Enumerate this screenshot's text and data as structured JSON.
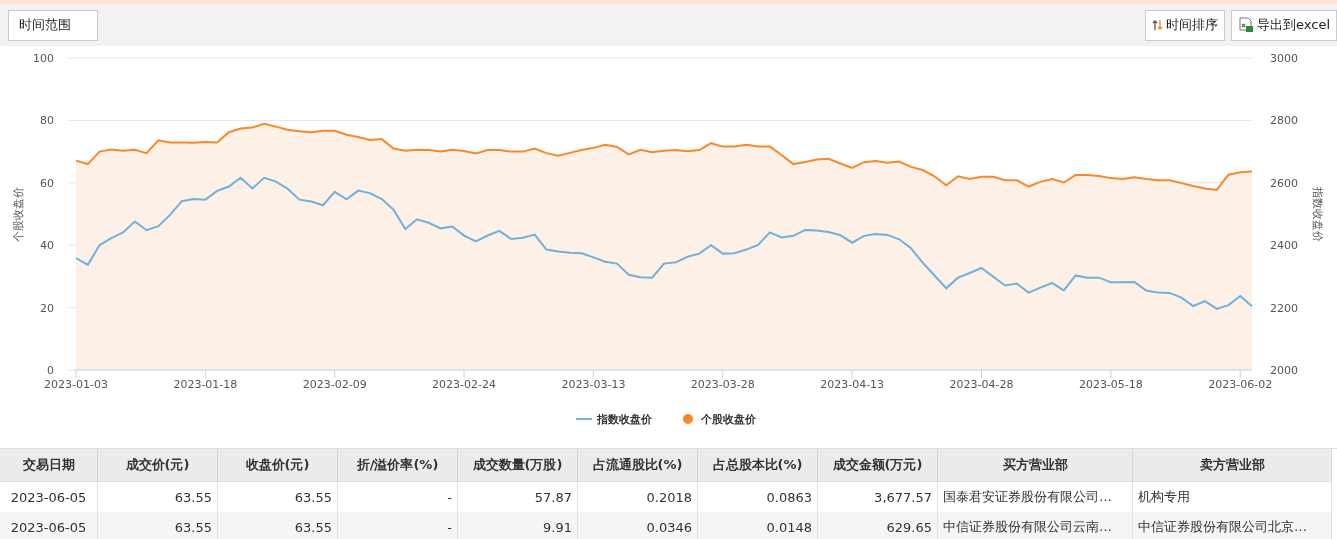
{
  "toolbar": {
    "range_button": "时间范围",
    "sort_button": "时间排序",
    "export_button": "导出到excel"
  },
  "chart": {
    "chart_data": {
      "type": "line",
      "categories": [
        "2023-01-03",
        null,
        null,
        null,
        null,
        null,
        null,
        null,
        null,
        null,
        null,
        "2023-01-18",
        null,
        null,
        null,
        null,
        null,
        null,
        null,
        null,
        null,
        null,
        "2023-02-09",
        null,
        null,
        null,
        null,
        null,
        null,
        null,
        null,
        null,
        null,
        "2023-02-24",
        null,
        null,
        null,
        null,
        null,
        null,
        null,
        null,
        null,
        null,
        "2023-03-13",
        null,
        null,
        null,
        null,
        null,
        null,
        null,
        null,
        null,
        null,
        "2023-03-28",
        null,
        null,
        null,
        null,
        null,
        null,
        null,
        null,
        null,
        null,
        "2023-04-13",
        null,
        null,
        null,
        null,
        null,
        null,
        null,
        null,
        null,
        null,
        "2023-04-28",
        null,
        null,
        null,
        null,
        null,
        null,
        null,
        null,
        null,
        null,
        "2023-05-18",
        null,
        null,
        null,
        null,
        null,
        null,
        null,
        null,
        null,
        null,
        "2023-06-02",
        null
      ],
      "grid": true,
      "legend": "bottom",
      "ylabel": "个股收盘价",
      "ylim": [
        0,
        100
      ],
      "yticks": [
        0,
        20,
        40,
        60,
        80,
        100
      ],
      "y2label": "指数收盘价",
      "y2lim": [
        2000,
        3000
      ],
      "y2ticks": [
        2000,
        2200,
        2400,
        2600,
        2800,
        3000
      ],
      "series": [
        {
          "name": "指数收盘价",
          "color": "#6fb0dd",
          "axis": "y2",
          "values": [
            2359,
            2337,
            2400,
            2423,
            2441,
            2476,
            2448,
            2461,
            2497,
            2541,
            2548,
            2546,
            2574,
            2588,
            2616,
            2582,
            2616,
            2604,
            2581,
            2546,
            2540,
            2528,
            2571,
            2547,
            2575,
            2567,
            2548,
            2514,
            2452,
            2483,
            2472,
            2454,
            2460,
            2431,
            2412,
            2431,
            2446,
            2420,
            2424,
            2434,
            2386,
            2380,
            2376,
            2374,
            2361,
            2347,
            2341,
            2305,
            2297,
            2296,
            2341,
            2345,
            2363,
            2373,
            2400,
            2373,
            2374,
            2386,
            2401,
            2441,
            2425,
            2430,
            2449,
            2447,
            2442,
            2432,
            2408,
            2430,
            2436,
            2433,
            2419,
            2390,
            2344,
            2303,
            2262,
            2296,
            2311,
            2327,
            2299,
            2271,
            2277,
            2248,
            2264,
            2279,
            2255,
            2303,
            2296,
            2296,
            2281,
            2281,
            2282,
            2255,
            2248,
            2247,
            2232,
            2205,
            2221,
            2196,
            2208,
            2237,
            2204
          ]
        },
        {
          "name": "个股收盘价",
          "color": "#f7892b",
          "type": "area",
          "values": [
            67.1,
            66,
            70,
            70.7,
            70.3,
            70.6,
            69.5,
            73.6,
            72.9,
            72.9,
            72.8,
            73.1,
            72.9,
            76.2,
            77.4,
            77.7,
            78.9,
            78,
            77,
            76.5,
            76.2,
            76.7,
            76.7,
            75.4,
            74.7,
            73.7,
            74,
            71,
            70.3,
            70.6,
            70.5,
            70,
            70.6,
            70.2,
            69.4,
            70.5,
            70.5,
            70,
            70,
            71,
            69.5,
            68.7,
            69.6,
            70.5,
            71.2,
            72.2,
            71.5,
            69.1,
            70.6,
            69.8,
            70.3,
            70.5,
            70.1,
            70.5,
            72.7,
            71.6,
            71.6,
            72.2,
            71.6,
            71.6,
            68.9,
            66,
            66.7,
            67.5,
            67.7,
            66.2,
            64.8,
            66.6,
            67,
            66.4,
            66.8,
            65.1,
            64.1,
            62.1,
            59.2,
            62.1,
            61.2,
            61.9,
            61.9,
            60.8,
            60.8,
            58.8,
            60.3,
            61.2,
            60.1,
            62.5,
            62.5,
            62.2,
            61.5,
            61.2,
            61.8,
            61.2,
            60.8,
            60.8,
            59.9,
            59,
            58.2,
            57.7,
            62.6,
            63.4,
            63.6
          ]
        }
      ]
    }
  },
  "table": {
    "columns": [
      "交易日期",
      "成交价(元)",
      "收盘价(元)",
      "折/溢价率(%)",
      "成交数量(万股)",
      "占流通股比(%)",
      "占总股本比(%)",
      "成交金额(万元)",
      "买方营业部",
      "卖方营业部"
    ],
    "rows": [
      [
        "2023-06-05",
        "63.55",
        "63.55",
        "-",
        "57.87",
        "0.2018",
        "0.0863",
        "3,677.57",
        "国泰君安证券股份有限公司…",
        "机构专用"
      ],
      [
        "2023-06-05",
        "63.55",
        "63.55",
        "-",
        "9.91",
        "0.0346",
        "0.0148",
        "629.65",
        "中信证券股份有限公司云南…",
        "中信证券股份有限公司北京…"
      ]
    ]
  }
}
